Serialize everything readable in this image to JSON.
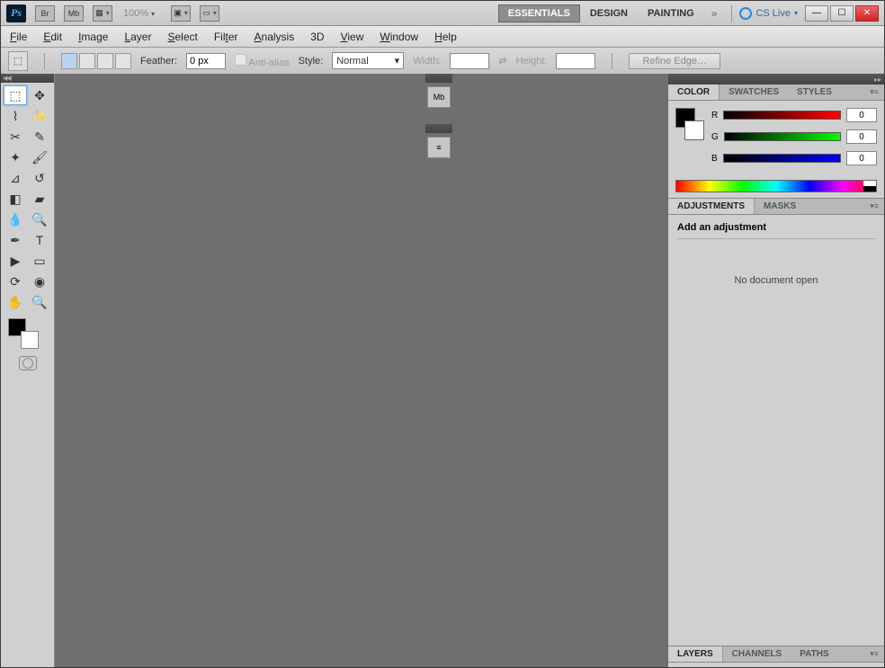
{
  "app": {
    "logo": "Ps",
    "zoom": "100%",
    "cslive": "CS Live"
  },
  "workspaces": {
    "essentials": "ESSENTIALS",
    "design": "DESIGN",
    "painting": "PAINTING"
  },
  "menu": {
    "file": "File",
    "edit": "Edit",
    "image": "Image",
    "layer": "Layer",
    "select": "Select",
    "filter": "Filter",
    "analysis": "Analysis",
    "threed": "3D",
    "view": "View",
    "window": "Window",
    "help": "Help"
  },
  "options": {
    "feather_label": "Feather:",
    "feather_value": "0 px",
    "antialias": "Anti-alias",
    "style_label": "Style:",
    "style_value": "Normal",
    "width_label": "Width:",
    "height_label": "Height:",
    "refine": "Refine Edge…"
  },
  "color": {
    "tab_color": "COLOR",
    "tab_swatches": "SWATCHES",
    "tab_styles": "STYLES",
    "r": "R",
    "g": "G",
    "b": "B",
    "rv": "0",
    "gv": "0",
    "bv": "0"
  },
  "adjustments": {
    "tab_adj": "ADJUSTMENTS",
    "tab_masks": "MASKS",
    "title": "Add an adjustment",
    "msg": "No document open"
  },
  "layers": {
    "tab_layers": "LAYERS",
    "tab_channels": "CHANNELS",
    "tab_paths": "PATHS"
  },
  "tools": [
    "marquee",
    "move",
    "lasso",
    "quick-select",
    "crop",
    "eyedropper",
    "spot-heal",
    "brush",
    "clone",
    "history-brush",
    "eraser",
    "gradient",
    "blur",
    "dodge",
    "pen",
    "type",
    "path-select",
    "shape",
    "threed-rotate",
    "threed-orbit",
    "hand",
    "zoom"
  ]
}
